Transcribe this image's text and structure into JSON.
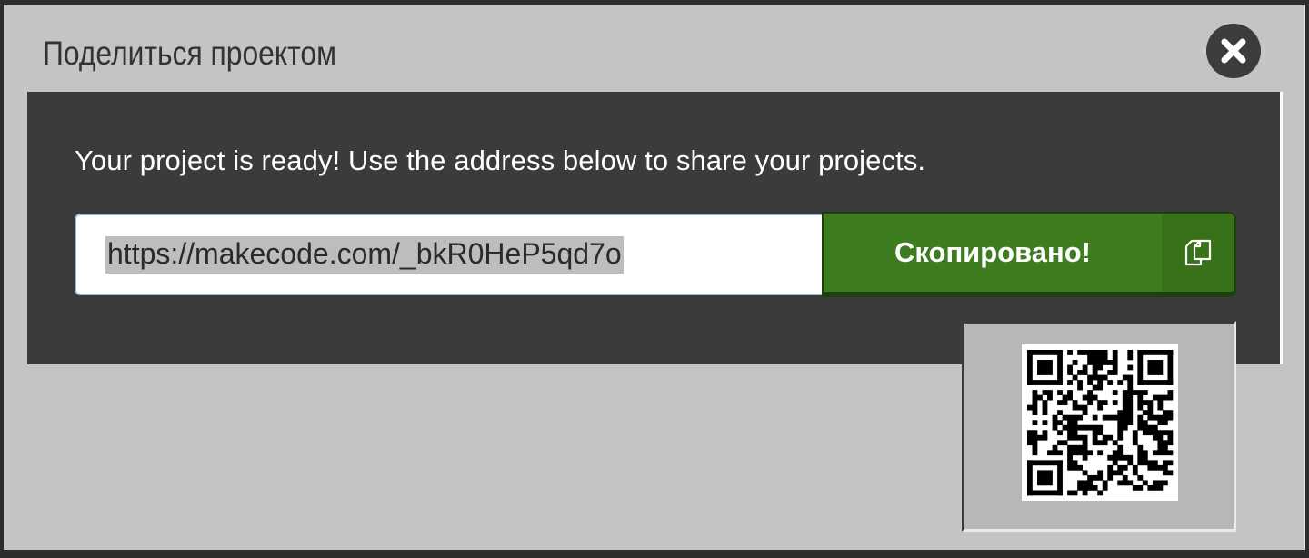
{
  "dialog": {
    "title": "Поделиться проектом",
    "close_icon": "close-icon"
  },
  "share": {
    "message": "Your project is ready! Use the address below to share your projects.",
    "url": "https://makecode.com/_bkR0HeP5qd7o",
    "copy_label": "Скопировано!",
    "copy_icon": "copy-icon"
  },
  "qr": {
    "icon": "qr-code"
  },
  "colors": {
    "modal_bg": "#c4c4c4",
    "content_bg": "#3b3b3b",
    "button_green": "#3d7c1f"
  }
}
